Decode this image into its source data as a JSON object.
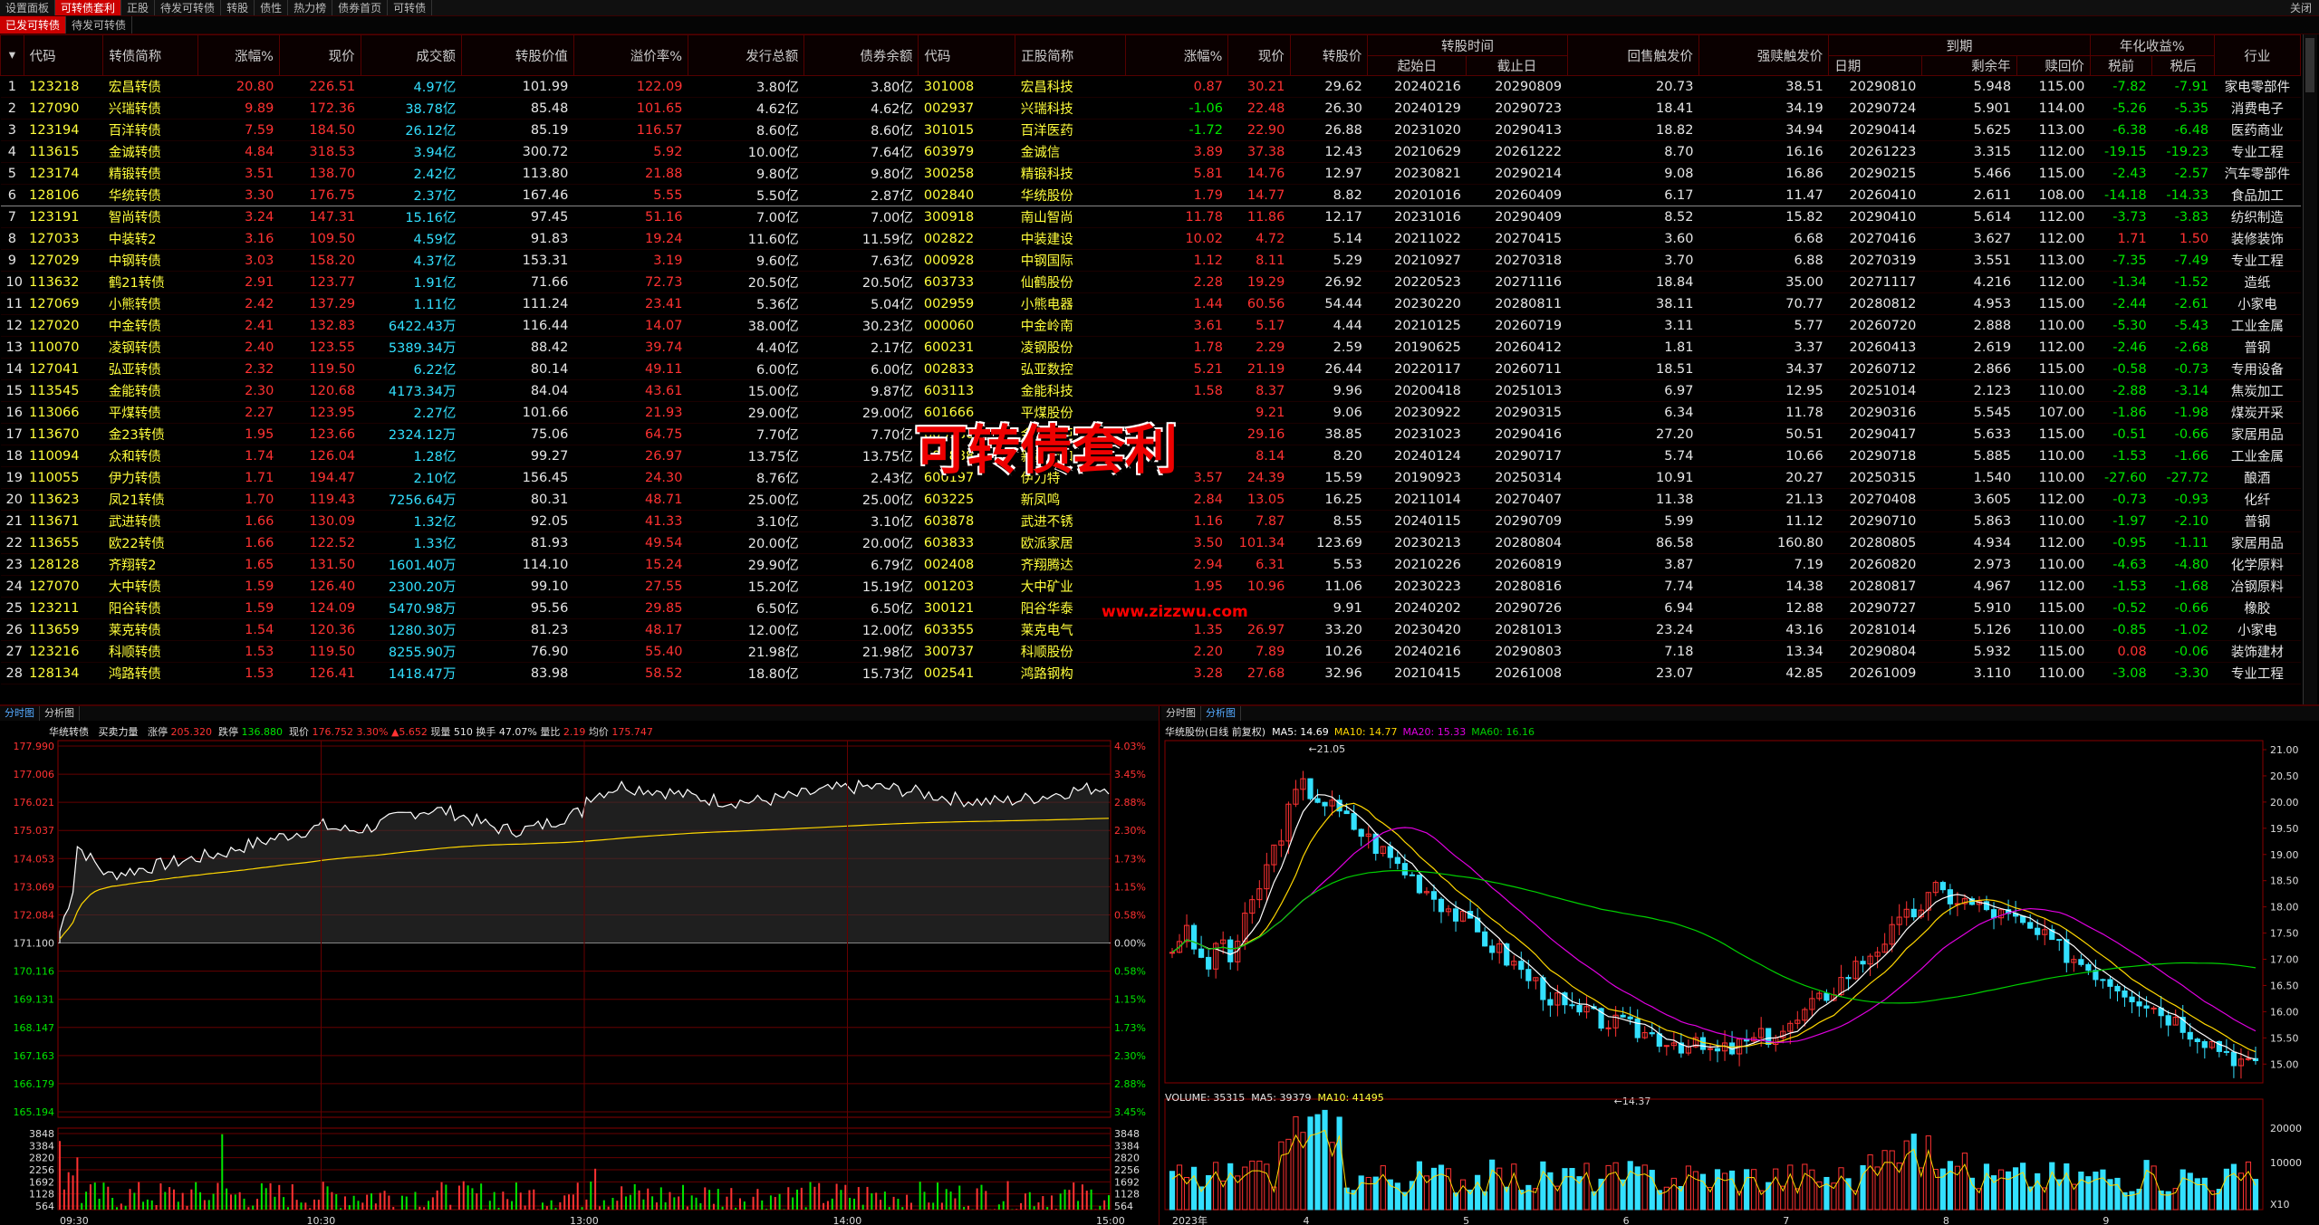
{
  "top_tabs": [
    "设置面板",
    "可转债套利",
    "正股",
    "待发可转债",
    "转股",
    "债性",
    "热力榜",
    "债券首页",
    "可转债"
  ],
  "close_label": "关闭",
  "sub_tabs": [
    "已发可转债",
    "待发可转债"
  ],
  "table": {
    "header_top": {
      "convert_time": "转股时间",
      "maturity": "到期",
      "annual_yield": "年化收益%"
    },
    "headers": [
      "代码",
      "转债简称",
      "涨幅%",
      "现价",
      "成交额",
      "转股价值",
      "溢价率%",
      "发行总额",
      "债券余额",
      "代码",
      "正股简称",
      "涨幅%",
      "现价",
      "转股价",
      "起始日",
      "截止日",
      "回售触发价",
      "强赎触发价",
      "日期",
      "剩余年",
      "赎回价",
      "税前",
      "税后",
      "行业"
    ],
    "rows": [
      [
        "1",
        "123218",
        "宏昌转债",
        "20.80",
        "226.51",
        "4.97亿",
        "101.99",
        "122.09",
        "3.80亿",
        "3.80亿",
        "301008",
        "宏昌科技",
        "0.87",
        "30.21",
        "29.62",
        "20240216",
        "20290809",
        "20.73",
        "38.51",
        "20290810",
        "5.948",
        "115.00",
        "-7.82",
        "-7.91",
        "家电零部件"
      ],
      [
        "2",
        "127090",
        "兴瑞转债",
        "9.89",
        "172.36",
        "38.78亿",
        "85.48",
        "101.65",
        "4.62亿",
        "4.62亿",
        "002937",
        "兴瑞科技",
        "-1.06",
        "22.48",
        "26.30",
        "20240129",
        "20290723",
        "18.41",
        "34.19",
        "20290724",
        "5.901",
        "114.00",
        "-5.26",
        "-5.35",
        "消费电子"
      ],
      [
        "3",
        "123194",
        "百洋转债",
        "7.59",
        "184.50",
        "26.12亿",
        "85.19",
        "116.57",
        "8.60亿",
        "8.60亿",
        "301015",
        "百洋医药",
        "-1.72",
        "22.90",
        "26.88",
        "20231020",
        "20290413",
        "18.82",
        "34.94",
        "20290414",
        "5.625",
        "113.00",
        "-6.38",
        "-6.48",
        "医药商业"
      ],
      [
        "4",
        "113615",
        "金诚转债",
        "4.84",
        "318.53",
        "3.94亿",
        "300.72",
        "5.92",
        "10.00亿",
        "7.64亿",
        "603979",
        "金诚信",
        "3.89",
        "37.38",
        "12.43",
        "20210629",
        "20261222",
        "8.70",
        "16.16",
        "20261223",
        "3.315",
        "112.00",
        "-19.15",
        "-19.23",
        "专业工程"
      ],
      [
        "5",
        "123174",
        "精锻转债",
        "3.51",
        "138.70",
        "2.42亿",
        "113.80",
        "21.88",
        "9.80亿",
        "9.80亿",
        "300258",
        "精锻科技",
        "5.81",
        "14.76",
        "12.97",
        "20230821",
        "20290214",
        "9.08",
        "16.86",
        "20290215",
        "5.466",
        "115.00",
        "-2.43",
        "-2.57",
        "汽车零部件"
      ],
      [
        "6",
        "128106",
        "华统转债",
        "3.30",
        "176.75",
        "2.37亿",
        "167.46",
        "5.55",
        "5.50亿",
        "2.87亿",
        "002840",
        "华统股份",
        "1.79",
        "14.77",
        "8.82",
        "20201016",
        "20260409",
        "6.17",
        "11.47",
        "20260410",
        "2.611",
        "108.00",
        "-14.18",
        "-14.33",
        "食品加工"
      ],
      [
        "7",
        "123191",
        "智尚转债",
        "3.24",
        "147.31",
        "15.16亿",
        "97.45",
        "51.16",
        "7.00亿",
        "7.00亿",
        "300918",
        "南山智尚",
        "11.78",
        "11.86",
        "12.17",
        "20231016",
        "20290409",
        "8.52",
        "15.82",
        "20290410",
        "5.614",
        "112.00",
        "-3.73",
        "-3.83",
        "纺织制造"
      ],
      [
        "8",
        "127033",
        "中装转2",
        "3.16",
        "109.50",
        "4.59亿",
        "91.83",
        "19.24",
        "11.60亿",
        "11.59亿",
        "002822",
        "中装建设",
        "10.02",
        "4.72",
        "5.14",
        "20211022",
        "20270415",
        "3.60",
        "6.68",
        "20270416",
        "3.627",
        "112.00",
        "1.71",
        "1.50",
        "装修装饰"
      ],
      [
        "9",
        "127029",
        "中钢转债",
        "3.03",
        "158.20",
        "4.37亿",
        "153.31",
        "3.19",
        "9.60亿",
        "7.63亿",
        "000928",
        "中钢国际",
        "1.12",
        "8.11",
        "5.29",
        "20210927",
        "20270318",
        "3.70",
        "6.88",
        "20270319",
        "3.551",
        "113.00",
        "-7.35",
        "-7.49",
        "专业工程"
      ],
      [
        "10",
        "113632",
        "鹤21转债",
        "2.91",
        "123.77",
        "1.91亿",
        "71.66",
        "72.73",
        "20.50亿",
        "20.50亿",
        "603733",
        "仙鹤股份",
        "2.28",
        "19.29",
        "26.92",
        "20220523",
        "20271116",
        "18.84",
        "35.00",
        "20271117",
        "4.216",
        "112.00",
        "-1.34",
        "-1.52",
        "造纸"
      ],
      [
        "11",
        "127069",
        "小熊转债",
        "2.42",
        "137.29",
        "1.11亿",
        "111.24",
        "23.41",
        "5.36亿",
        "5.04亿",
        "002959",
        "小熊电器",
        "1.44",
        "60.56",
        "54.44",
        "20230220",
        "20280811",
        "38.11",
        "70.77",
        "20280812",
        "4.953",
        "115.00",
        "-2.44",
        "-2.61",
        "小家电"
      ],
      [
        "12",
        "127020",
        "中金转债",
        "2.41",
        "132.83",
        "6422.43万",
        "116.44",
        "14.07",
        "38.00亿",
        "30.23亿",
        "000060",
        "中金岭南",
        "3.61",
        "5.17",
        "4.44",
        "20210125",
        "20260719",
        "3.11",
        "5.77",
        "20260720",
        "2.888",
        "110.00",
        "-5.30",
        "-5.43",
        "工业金属"
      ],
      [
        "13",
        "110070",
        "凌钢转债",
        "2.40",
        "123.55",
        "5389.34万",
        "88.42",
        "39.74",
        "4.40亿",
        "2.17亿",
        "600231",
        "凌钢股份",
        "1.78",
        "2.29",
        "2.59",
        "20190625",
        "20260412",
        "1.81",
        "3.37",
        "20260413",
        "2.619",
        "112.00",
        "-2.46",
        "-2.68",
        "普钢"
      ],
      [
        "14",
        "127041",
        "弘亚转债",
        "2.32",
        "119.50",
        "6.22亿",
        "80.14",
        "49.11",
        "6.00亿",
        "6.00亿",
        "002833",
        "弘亚数控",
        "5.21",
        "21.19",
        "26.44",
        "20220117",
        "20260711",
        "18.51",
        "34.37",
        "20260712",
        "2.866",
        "115.00",
        "-0.58",
        "-0.73",
        "专用设备"
      ],
      [
        "15",
        "113545",
        "金能转债",
        "2.30",
        "120.68",
        "4173.34万",
        "84.04",
        "43.61",
        "15.00亿",
        "9.87亿",
        "603113",
        "金能科技",
        "1.58",
        "8.37",
        "9.96",
        "20200418",
        "20251013",
        "6.97",
        "12.95",
        "20251014",
        "2.123",
        "110.00",
        "-2.88",
        "-3.14",
        "焦炭加工"
      ],
      [
        "16",
        "113066",
        "平煤转债",
        "2.27",
        "123.95",
        "2.27亿",
        "101.66",
        "21.93",
        "29.00亿",
        "29.00亿",
        "601666",
        "平煤股份",
        "",
        "9.21",
        "9.06",
        "20230922",
        "20290315",
        "6.34",
        "11.78",
        "20290316",
        "5.545",
        "107.00",
        "-1.86",
        "-1.98",
        "煤炭开采"
      ],
      [
        "17",
        "113670",
        "金23转债",
        "1.95",
        "123.66",
        "2324.12万",
        "75.06",
        "64.75",
        "7.70亿",
        "7.70亿",
        "603180",
        "金牌厨柜",
        "",
        "29.16",
        "38.85",
        "20231023",
        "20290416",
        "27.20",
        "50.51",
        "20290417",
        "5.633",
        "115.00",
        "-0.51",
        "-0.66",
        "家居用品"
      ],
      [
        "18",
        "110094",
        "众和转债",
        "1.74",
        "126.04",
        "1.28亿",
        "99.27",
        "26.97",
        "13.75亿",
        "13.75亿",
        "600888",
        "新疆众和",
        "",
        "8.14",
        "8.20",
        "20240124",
        "20290717",
        "5.74",
        "10.66",
        "20290718",
        "5.885",
        "110.00",
        "-1.53",
        "-1.66",
        "工业金属"
      ],
      [
        "19",
        "110055",
        "伊力转债",
        "1.71",
        "194.47",
        "2.10亿",
        "156.45",
        "24.30",
        "8.76亿",
        "2.43亿",
        "600197",
        "伊力特",
        "3.57",
        "24.39",
        "15.59",
        "20190923",
        "20250314",
        "10.91",
        "20.27",
        "20250315",
        "1.540",
        "110.00",
        "-27.60",
        "-27.72",
        "酿酒"
      ],
      [
        "20",
        "113623",
        "凤21转债",
        "1.70",
        "119.43",
        "7256.64万",
        "80.31",
        "48.71",
        "25.00亿",
        "25.00亿",
        "603225",
        "新凤鸣",
        "2.84",
        "13.05",
        "16.25",
        "20211014",
        "20270407",
        "11.38",
        "21.13",
        "20270408",
        "3.605",
        "112.00",
        "-0.73",
        "-0.93",
        "化纤"
      ],
      [
        "21",
        "113671",
        "武进转债",
        "1.66",
        "130.09",
        "1.32亿",
        "92.05",
        "41.33",
        "3.10亿",
        "3.10亿",
        "603878",
        "武进不锈",
        "1.16",
        "7.87",
        "8.55",
        "20240115",
        "20290709",
        "5.99",
        "11.12",
        "20290710",
        "5.863",
        "110.00",
        "-1.97",
        "-2.10",
        "普钢"
      ],
      [
        "22",
        "113655",
        "欧22转债",
        "1.66",
        "122.52",
        "1.33亿",
        "81.93",
        "49.54",
        "20.00亿",
        "20.00亿",
        "603833",
        "欧派家居",
        "3.50",
        "101.34",
        "123.69",
        "20230213",
        "20280804",
        "86.58",
        "160.80",
        "20280805",
        "4.934",
        "112.00",
        "-0.95",
        "-1.11",
        "家居用品"
      ],
      [
        "23",
        "128128",
        "齐翔转2",
        "1.65",
        "131.50",
        "1601.40万",
        "114.10",
        "15.24",
        "29.90亿",
        "6.79亿",
        "002408",
        "齐翔腾达",
        "2.94",
        "6.31",
        "5.53",
        "20210226",
        "20260819",
        "3.87",
        "7.19",
        "20260820",
        "2.973",
        "110.00",
        "-4.63",
        "-4.80",
        "化学原料"
      ],
      [
        "24",
        "127070",
        "大中转债",
        "1.59",
        "126.40",
        "2300.20万",
        "99.10",
        "27.55",
        "15.20亿",
        "15.19亿",
        "001203",
        "大中矿业",
        "1.95",
        "10.96",
        "11.06",
        "20230223",
        "20280816",
        "7.74",
        "14.38",
        "20280817",
        "4.967",
        "112.00",
        "-1.53",
        "-1.68",
        "冶钢原料"
      ],
      [
        "25",
        "123211",
        "阳谷转债",
        "1.59",
        "124.09",
        "5470.98万",
        "95.56",
        "29.85",
        "6.50亿",
        "6.50亿",
        "300121",
        "阳谷华泰",
        "",
        "",
        "9.91",
        "20240202",
        "20290726",
        "6.94",
        "12.88",
        "20290727",
        "5.910",
        "115.00",
        "-0.52",
        "-0.66",
        "橡胶"
      ],
      [
        "26",
        "113659",
        "莱克转债",
        "1.54",
        "120.36",
        "1280.30万",
        "81.23",
        "48.17",
        "12.00亿",
        "12.00亿",
        "603355",
        "莱克电气",
        "1.35",
        "26.97",
        "33.20",
        "20230420",
        "20281013",
        "23.24",
        "43.16",
        "20281014",
        "5.126",
        "110.00",
        "-0.85",
        "-1.02",
        "小家电"
      ],
      [
        "27",
        "123216",
        "科顺转债",
        "1.53",
        "119.50",
        "8255.90万",
        "76.90",
        "55.40",
        "21.98亿",
        "21.98亿",
        "300737",
        "科顺股份",
        "2.20",
        "7.89",
        "10.26",
        "20240216",
        "20290803",
        "7.18",
        "13.34",
        "20290804",
        "5.932",
        "115.00",
        "0.08",
        "-0.06",
        "装饰建材"
      ],
      [
        "28",
        "128134",
        "鸿路转债",
        "1.53",
        "126.41",
        "1418.47万",
        "83.98",
        "58.52",
        "18.80亿",
        "15.73亿",
        "002541",
        "鸿路钢构",
        "3.28",
        "27.68",
        "32.96",
        "20210415",
        "20261008",
        "23.07",
        "42.85",
        "20261009",
        "3.110",
        "110.00",
        "-3.08",
        "-3.30",
        "专业工程"
      ]
    ]
  },
  "watermark": "可转债套利",
  "web_url": "www.zizzwu.com",
  "left_panel": {
    "tabs": [
      "分时图",
      "分析图"
    ],
    "info": {
      "name": "华统转债",
      "label": "买卖力量",
      "buy_label": "涨停",
      "buy_val": "205.320",
      "sell_label": "跌停",
      "sell_val": "136.880",
      "price_label": "现价",
      "price": "176.752",
      "pct": "3.30%",
      "chg": "▲5.652",
      "vol_label": "现量",
      "vol": "510",
      "turn_label": "换手",
      "turn": "47.07%",
      "ratio_label": "量比",
      "ratio": "2.19",
      "avg_label": "均价",
      "avg": "175.747"
    },
    "price_ticks": [
      "177.990",
      "177.006",
      "176.021",
      "175.037",
      "174.053",
      "173.069",
      "172.084",
      "171.100",
      "170.116",
      "169.131",
      "168.147",
      "167.163",
      "166.179",
      "165.194"
    ],
    "pct_ticks": [
      "4.03%",
      "3.45%",
      "2.88%",
      "2.30%",
      "1.73%",
      "1.15%",
      "0.58%",
      "0.00%",
      "0.58%",
      "1.15%",
      "1.73%",
      "2.30%",
      "2.88%",
      "3.45%"
    ],
    "vol_ticks": [
      "3848",
      "3384",
      "2820",
      "2256",
      "1692",
      "1128",
      "564"
    ],
    "time_ticks": [
      "09:30",
      "10:30",
      "13:00",
      "14:00",
      "15:00"
    ],
    "colors": {
      "price": "#ffffff",
      "avg": "#ffd700",
      "up": "#ff3232"
    }
  },
  "right_panel": {
    "tabs": [
      "分时图",
      "分析图"
    ],
    "title": "华统股份(日线 前复权)",
    "ma": [
      {
        "label": "MA5: 14.69",
        "color": "#ffffff"
      },
      {
        "label": "MA10: 14.77",
        "color": "#ffd700"
      },
      {
        "label": "MA20: 15.33",
        "color": "#e000e0"
      },
      {
        "label": "MA60: 16.16",
        "color": "#00d000"
      }
    ],
    "high_label": "21.05",
    "low_label": "14.37",
    "price_ticks": [
      "21.00",
      "20.50",
      "20.00",
      "19.50",
      "19.00",
      "18.50",
      "18.00",
      "17.50",
      "17.00",
      "16.50",
      "16.00",
      "15.50",
      "15.00"
    ],
    "volume_info": {
      "label": "VOLUME: 35315",
      "ma5": "MA5: 39379",
      "ma10": "MA10: 41495"
    },
    "vol_ticks": [
      "20000",
      "10000"
    ],
    "x_ticks": [
      "2023年",
      "4",
      "5",
      "6",
      "7",
      "8",
      "9"
    ],
    "vol_unit": "X10"
  }
}
